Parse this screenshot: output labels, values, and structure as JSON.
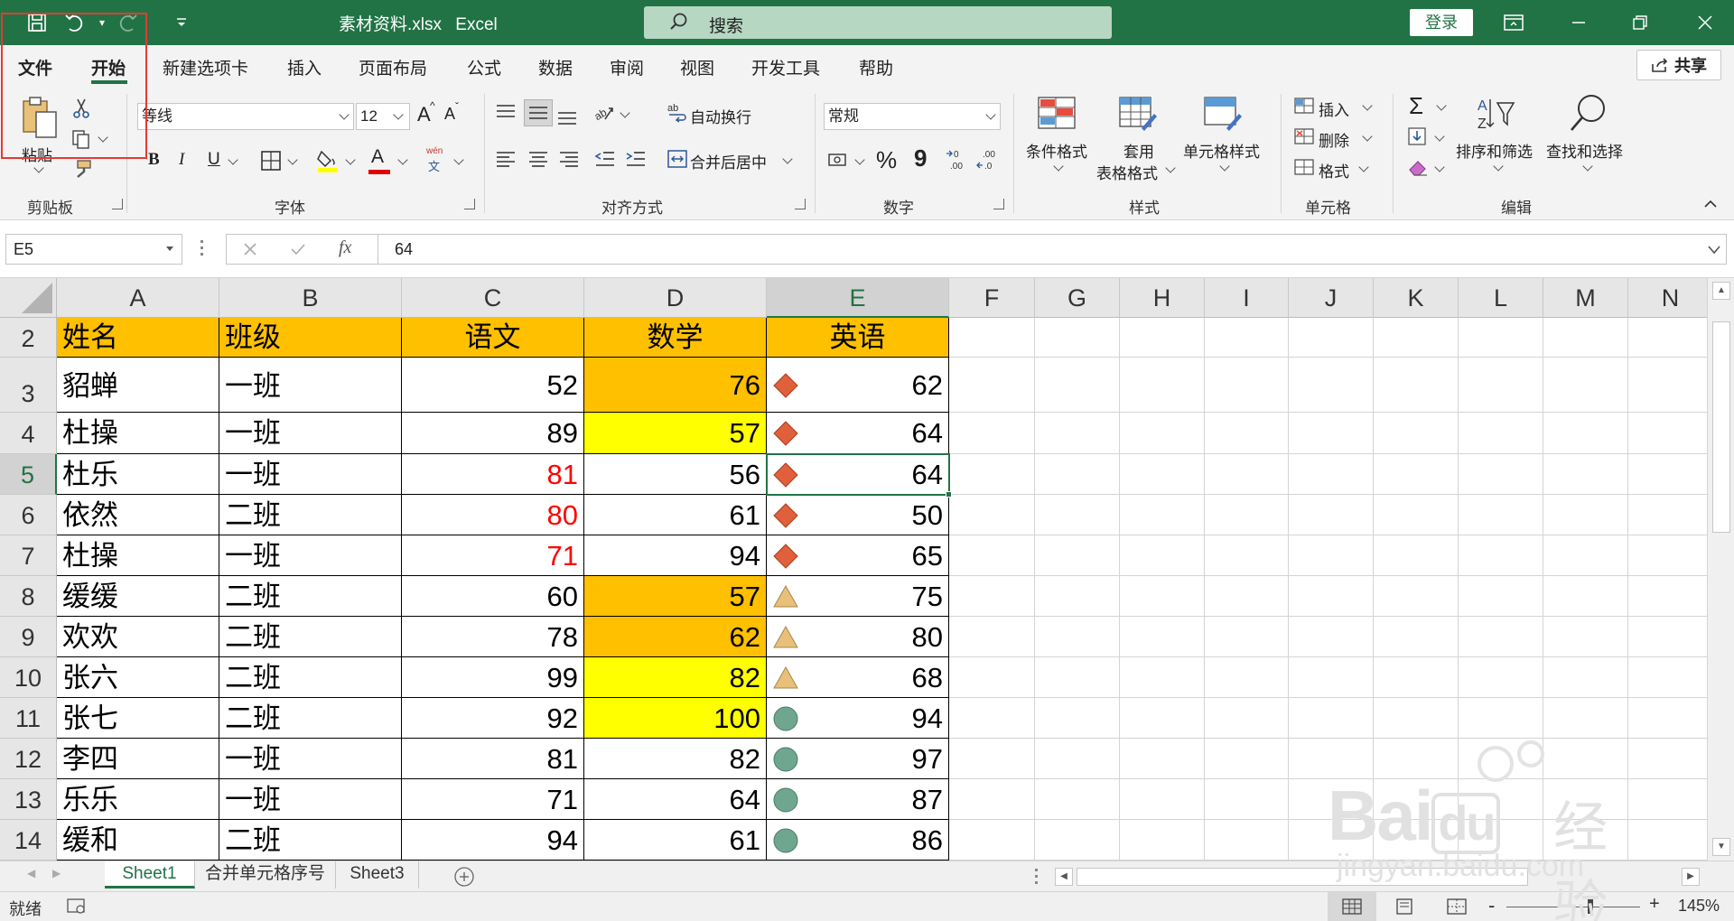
{
  "titlebar": {
    "filename": "素材资料.xlsx",
    "app": "Excel",
    "search_placeholder": "搜索",
    "login_label": "登录"
  },
  "tabs": [
    {
      "label": "文件",
      "bold": true
    },
    {
      "label": "开始",
      "bold": true,
      "active": true
    },
    {
      "label": "新建选项卡"
    },
    {
      "label": "插入"
    },
    {
      "label": "页面布局"
    },
    {
      "label": "公式"
    },
    {
      "label": "数据"
    },
    {
      "label": "审阅"
    },
    {
      "label": "视图"
    },
    {
      "label": "开发工具"
    },
    {
      "label": "帮助"
    }
  ],
  "share_label": "共享",
  "ribbon": {
    "clipboard": {
      "paste_label": "粘贴",
      "group_label": "剪贴板"
    },
    "font": {
      "font_name": "等线",
      "font_size": "12",
      "group_label": "字体",
      "bold": "B",
      "italic": "I",
      "underline": "U",
      "increase": "A",
      "decrease": "A",
      "wen": "wén",
      "wen_char": "文",
      "font_color_glyph": "A"
    },
    "alignment": {
      "wrap_label": "自动换行",
      "merge_label": "合并后居中",
      "group_label": "对齐方式"
    },
    "number": {
      "format": "常规",
      "percent": "%",
      "comma": "9",
      "group_label": "数字"
    },
    "styles": {
      "conditional_label": "条件格式",
      "table_label_line1": "套用",
      "table_label_line2": "表格格式",
      "cell_style_label": "单元格样式",
      "group_label": "样式"
    },
    "cells": {
      "insert_label": "插入",
      "delete_label": "删除",
      "format_label": "格式",
      "group_label": "单元格"
    },
    "editing": {
      "sort_label": "排序和筛选",
      "find_label": "查找和选择",
      "group_label": "编辑",
      "sigma": "Σ"
    }
  },
  "formula_bar": {
    "name_box": "E5",
    "value": "64",
    "fx": "fx"
  },
  "columns": [
    "A",
    "B",
    "C",
    "D",
    "E",
    "F",
    "G",
    "H",
    "I",
    "J",
    "K",
    "L",
    "M",
    "N"
  ],
  "selected_column": "E",
  "selected_row": "5",
  "header_row": {
    "row": "2",
    "cells": [
      "姓名",
      "班级",
      "语文",
      "数学",
      "英语"
    ]
  },
  "rows": [
    {
      "row": "3",
      "name": "貂蝉",
      "class": "一班",
      "chinese": "52",
      "math": "76",
      "english": "62",
      "chinese_red": false,
      "math_fill": "#ffc000",
      "icon": "diamond"
    },
    {
      "row": "4",
      "name": "杜操",
      "class": "一班",
      "chinese": "89",
      "math": "57",
      "english": "64",
      "chinese_red": false,
      "math_fill": "#ffff00",
      "icon": "diamond"
    },
    {
      "row": "5",
      "name": "杜乐",
      "class": "一班",
      "chinese": "81",
      "math": "56",
      "english": "64",
      "chinese_red": true,
      "math_fill": "",
      "icon": "diamond"
    },
    {
      "row": "6",
      "name": "依然",
      "class": "二班",
      "chinese": "80",
      "math": "61",
      "english": "50",
      "chinese_red": true,
      "math_fill": "",
      "icon": "diamond"
    },
    {
      "row": "7",
      "name": "杜操",
      "class": "一班",
      "chinese": "71",
      "math": "94",
      "english": "65",
      "chinese_red": true,
      "math_fill": "",
      "icon": "diamond"
    },
    {
      "row": "8",
      "name": "缓缓",
      "class": "二班",
      "chinese": "60",
      "math": "57",
      "english": "75",
      "chinese_red": false,
      "math_fill": "#ffc000",
      "icon": "triangle"
    },
    {
      "row": "9",
      "name": "欢欢",
      "class": "二班",
      "chinese": "78",
      "math": "62",
      "english": "80",
      "chinese_red": false,
      "math_fill": "#ffc000",
      "icon": "triangle"
    },
    {
      "row": "10",
      "name": "张六",
      "class": "二班",
      "chinese": "99",
      "math": "82",
      "english": "68",
      "chinese_red": false,
      "math_fill": "#ffff00",
      "icon": "triangle"
    },
    {
      "row": "11",
      "name": "张七",
      "class": "二班",
      "chinese": "92",
      "math": "100",
      "english": "94",
      "chinese_red": false,
      "math_fill": "#ffff00",
      "icon": "circle"
    },
    {
      "row": "12",
      "name": "李四",
      "class": "一班",
      "chinese": "81",
      "math": "82",
      "english": "97",
      "chinese_red": false,
      "math_fill": "",
      "icon": "circle"
    },
    {
      "row": "13",
      "name": "乐乐",
      "class": "一班",
      "chinese": "71",
      "math": "64",
      "english": "87",
      "chinese_red": false,
      "math_fill": "",
      "icon": "circle"
    },
    {
      "row": "14",
      "name": "缓和",
      "class": "二班",
      "chinese": "94",
      "math": "61",
      "english": "86",
      "chinese_red": false,
      "math_fill": "",
      "icon": "circle"
    }
  ],
  "colors": {
    "excel_green": "#217346",
    "header_fill": "#ffc000",
    "red_text": "#ff0000",
    "diamond": "#e0603c",
    "triangle": "#e8c07a",
    "circle": "#6fa68f"
  },
  "sheets": [
    {
      "label": "Sheet1",
      "active": true
    },
    {
      "label": "合并单元格序号"
    },
    {
      "label": "Sheet3"
    }
  ],
  "status": {
    "ready": "就绪",
    "zoom": "145%",
    "minus": "-",
    "plus": "+"
  },
  "watermark": {
    "brand": "Bai",
    "brand2": "du",
    "jingyan": "经验",
    "url": "jingyan.baidu.com"
  }
}
